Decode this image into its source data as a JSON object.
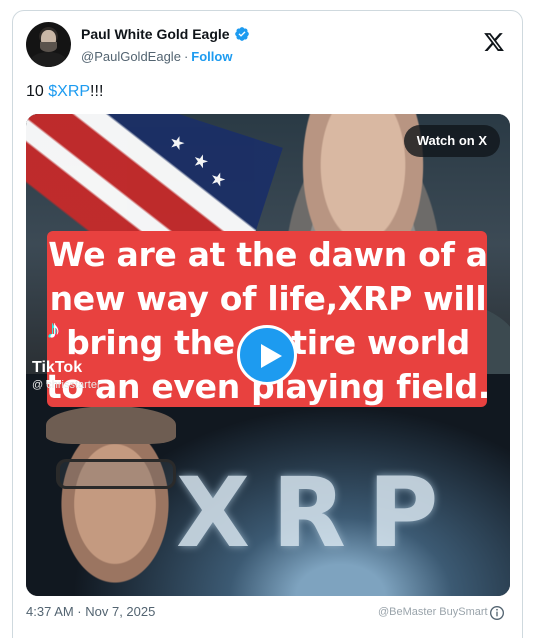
{
  "author": {
    "name": "Paul White Gold Eagle",
    "handle": "@PaulGoldEagle",
    "separator": "·",
    "follow_label": "Follow"
  },
  "tweet": {
    "text_prefix": "10 ",
    "cashtag": "$XRP",
    "text_suffix": "!!!"
  },
  "media": {
    "watch_label": "Watch on X",
    "caption_lines": [
      "We are at the dawn of a",
      "new way of life,XRP will",
      "bring the entire world",
      "to an even playing field."
    ],
    "tiktok_label": "TikTok",
    "tiktok_user": "@ chrisstarter",
    "overlay_text": "XRP"
  },
  "footer": {
    "timestamp": "4:37 AM · Nov 7, 2025",
    "watermark": "@BeMaster BuySmart"
  },
  "colors": {
    "accent": "#1d9bf0",
    "caption_bg": "#e8413f",
    "text": "#0f1419",
    "muted": "#536471"
  },
  "icons": {
    "verified": "verified-badge-icon",
    "x_logo": "x-logo-icon",
    "play": "play-icon",
    "info": "info-icon"
  }
}
